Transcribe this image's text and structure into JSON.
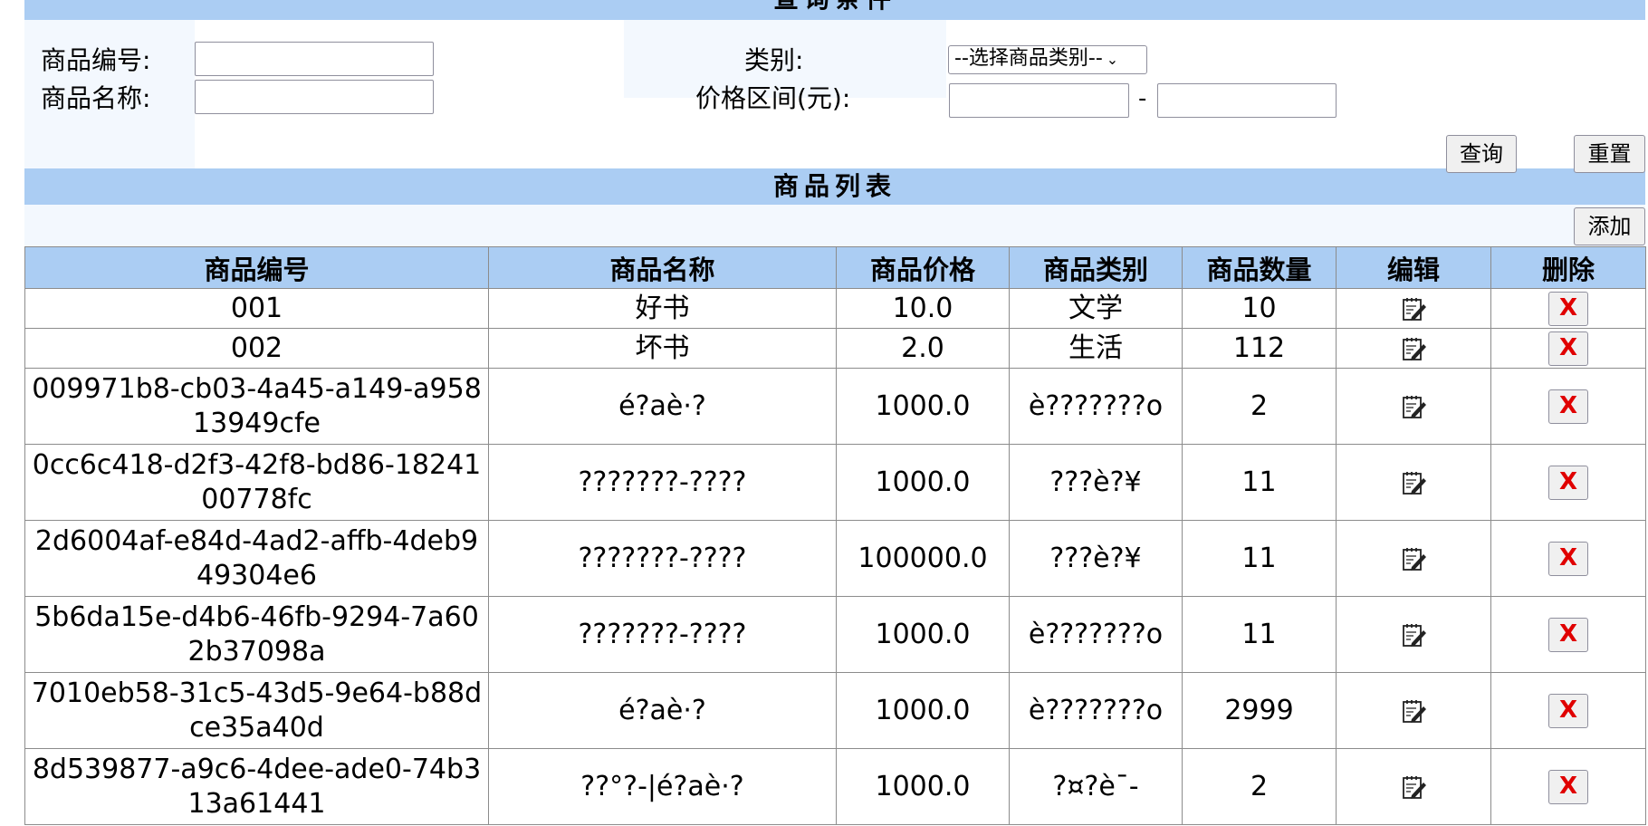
{
  "query": {
    "title": "查询条件",
    "labels": {
      "product_id": "商品编号:",
      "product_name": "商品名称:",
      "category": "类别:",
      "price_range": "价格区间(元):",
      "range_sep": "-"
    },
    "category_select": "--选择商品类别--",
    "product_id_value": "",
    "product_name_value": "",
    "price_min_value": "",
    "price_max_value": "",
    "search_button": "查询",
    "reset_button": "重置"
  },
  "list": {
    "title": "商品列表",
    "add_button": "添加",
    "columns": [
      "商品编号",
      "商品名称",
      "商品价格",
      "商品类别",
      "商品数量",
      "编辑",
      "删除"
    ],
    "delete_label": "X",
    "rows": [
      {
        "id": "001",
        "name": "好书",
        "price": "10.0",
        "category": "文学",
        "quantity": "10"
      },
      {
        "id": "002",
        "name": "坏书",
        "price": "2.0",
        "category": "生活",
        "quantity": "112"
      },
      {
        "id": "009971b8-cb03-4a45-a149-a95813949cfe",
        "name": "é?aè·?",
        "price": "1000.0",
        "category": "è???????o",
        "quantity": "2"
      },
      {
        "id": "0cc6c418-d2f3-42f8-bd86-1824100778fc",
        "name": "???????-????",
        "price": "1000.0",
        "category": "???è?¥",
        "quantity": "11"
      },
      {
        "id": "2d6004af-e84d-4ad2-affb-4deb949304e6",
        "name": "???????-????",
        "price": "100000.0",
        "category": "???è?¥",
        "quantity": "11"
      },
      {
        "id": "5b6da15e-d4b6-46fb-9294-7a602b37098a",
        "name": "???????-????",
        "price": "1000.0",
        "category": "è???????o",
        "quantity": "11"
      },
      {
        "id": "7010eb58-31c5-43d5-9e64-b88dce35a40d",
        "name": "é?aè·?",
        "price": "1000.0",
        "category": "è???????o",
        "quantity": "2999"
      },
      {
        "id": "8d539877-a9c6-4dee-ade0-74b313a61441",
        "name": "??°?-|é?aè·?",
        "price": "1000.0",
        "category": "?¤?è¯-",
        "quantity": "2"
      }
    ]
  },
  "colors": {
    "header_bg": "#abcdf3",
    "light_bg": "#f3f8fe",
    "delete_red": "#e00000"
  }
}
